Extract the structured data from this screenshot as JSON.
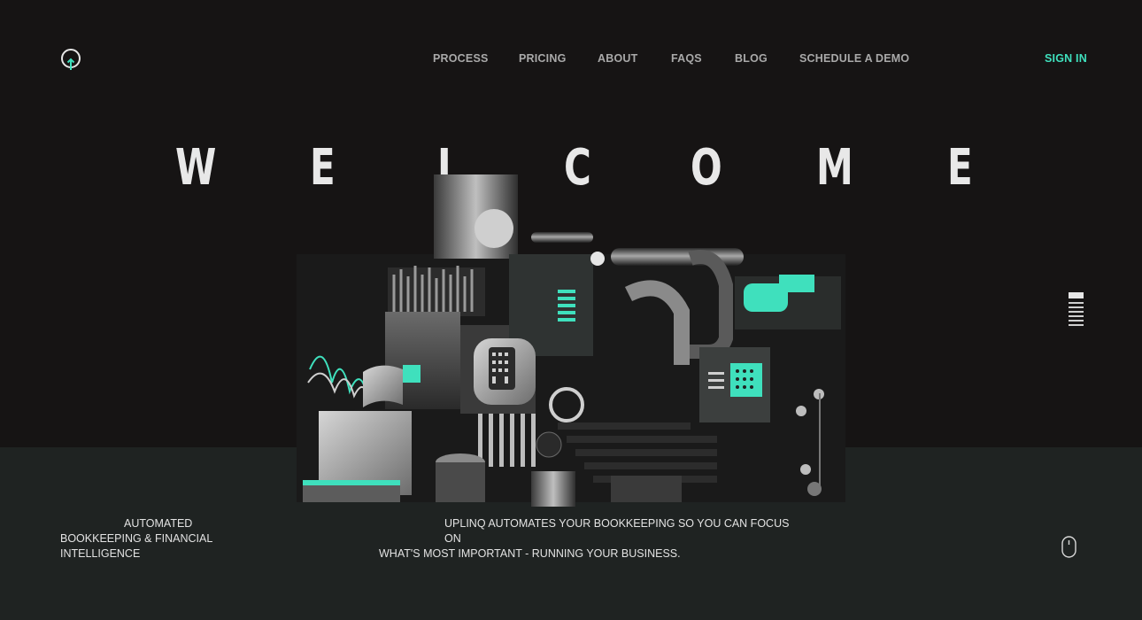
{
  "brand": {
    "logo_icon": "power-pin-icon",
    "accent_color": "#3fe0bd"
  },
  "nav": {
    "items": [
      {
        "label": "PROCESS"
      },
      {
        "label": "PRICING"
      },
      {
        "label": "ABOUT"
      },
      {
        "label": "FAQS"
      },
      {
        "label": "BLOG"
      },
      {
        "label": "SCHEDULE A DEMO"
      }
    ],
    "sign_in": "SIGN IN"
  },
  "hero": {
    "letters": [
      "W",
      "E",
      "L",
      "C",
      "O",
      "M",
      "E"
    ]
  },
  "side_nav": {
    "count": 7,
    "active_index": 0
  },
  "tagline_left": {
    "line1": "AUTOMATED",
    "line2": "BOOKKEEPING & FINANCIAL",
    "line3": "INTELLIGENCE"
  },
  "tagline_center": {
    "line1": "UPLINQ AUTOMATES YOUR BOOKKEEPING SO YOU CAN FOCUS ON",
    "line2": "WHAT'S MOST IMPORTANT - RUNNING YOUR BUSINESS."
  },
  "scroll_icon": "mouse-scroll-icon"
}
